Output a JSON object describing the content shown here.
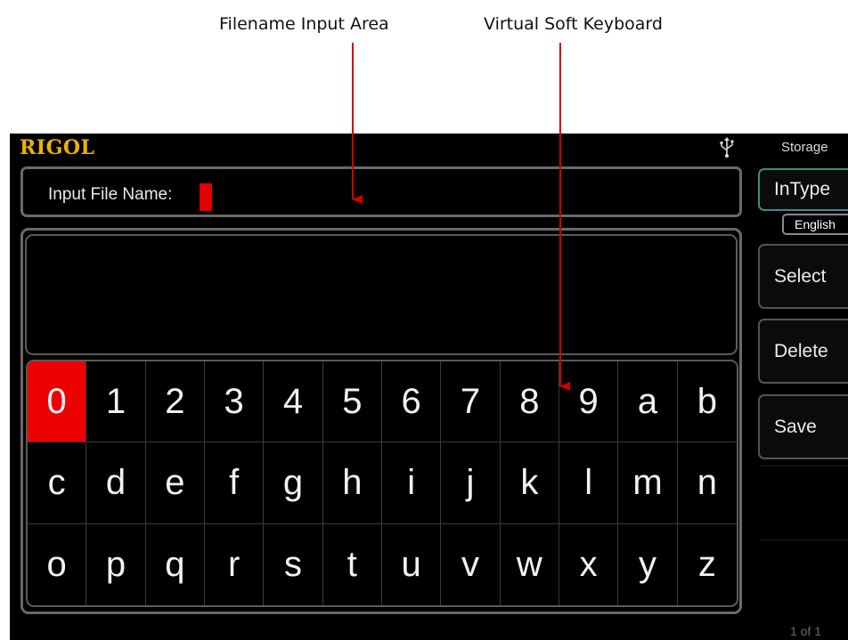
{
  "annotations": {
    "input_area": "Filename Input Area",
    "soft_keyboard": "Virtual Soft Keyboard"
  },
  "header": {
    "brand": "RIGOL",
    "usb_icon": "usb-icon"
  },
  "filename": {
    "label": "Input File Name:",
    "value": ""
  },
  "keyboard": {
    "keys": [
      "0",
      "1",
      "2",
      "3",
      "4",
      "5",
      "6",
      "7",
      "8",
      "9",
      "a",
      "b",
      "c",
      "d",
      "e",
      "f",
      "g",
      "h",
      "i",
      "j",
      "k",
      "l",
      "m",
      "n",
      "o",
      "p",
      "q",
      "r",
      "s",
      "t",
      "u",
      "v",
      "w",
      "x",
      "y",
      "z"
    ],
    "selected_key": "0"
  },
  "menu": {
    "title": "Storage",
    "intype_label": "InType",
    "intype_value": "English",
    "select_label": "Select",
    "delete_label": "Delete",
    "save_label": "Save",
    "page": "1 of 1"
  },
  "colors": {
    "brand": "#e8b400",
    "cursor": "#e00000",
    "selected_key": "#ee0000",
    "active_softkey_border": "#3a8e8a",
    "annotation_arrow": "#d00000"
  }
}
